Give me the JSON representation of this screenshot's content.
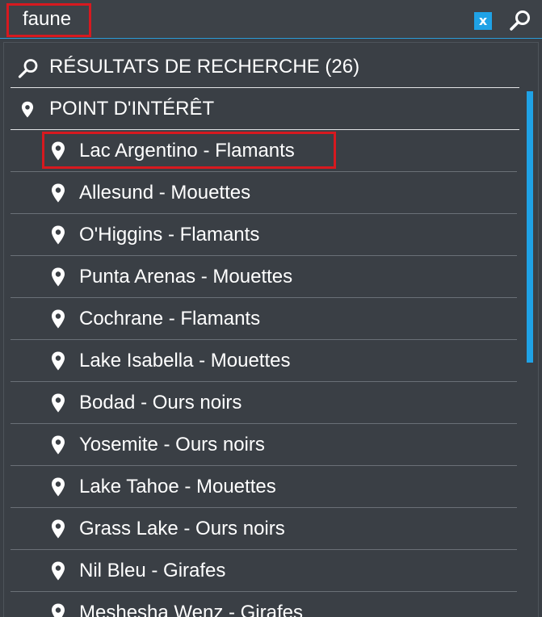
{
  "search": {
    "query": "faune",
    "clear_label": "x"
  },
  "results": {
    "header": "RÉSULTATS DE RECHERCHE (26)",
    "category": "POINT D'INTÉRÊT",
    "items": [
      {
        "label": "Lac Argentino - Flamants",
        "highlighted": true
      },
      {
        "label": "Allesund - Mouettes"
      },
      {
        "label": "O'Higgins - Flamants"
      },
      {
        "label": "Punta Arenas - Mouettes"
      },
      {
        "label": "Cochrane - Flamants"
      },
      {
        "label": "Lake Isabella - Mouettes"
      },
      {
        "label": "Bodad - Ours noirs"
      },
      {
        "label": "Yosemite - Ours noirs"
      },
      {
        "label": "Lake Tahoe - Mouettes"
      },
      {
        "label": "Grass Lake - Ours noirs"
      },
      {
        "label": "Nil Bleu - Girafes"
      },
      {
        "label": "Meshesha Wenz - Girafes"
      }
    ]
  },
  "colors": {
    "accent": "#1fa2e6",
    "highlight_border": "#d7191f",
    "background": "#3a3f45",
    "text": "#ffffff"
  }
}
